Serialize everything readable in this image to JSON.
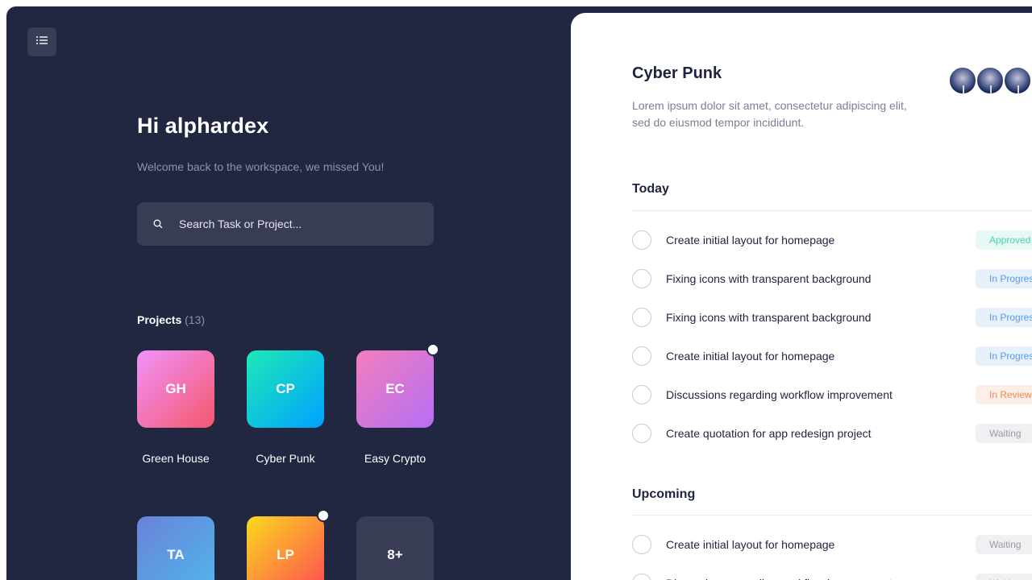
{
  "sidebar": {
    "menu_icon": "list-icon",
    "greeting": "Hi alphardex",
    "subtitle": "Welcome back to the workspace, we missed You!",
    "search": {
      "placeholder": "Search Task or Project...",
      "icon": "search-icon"
    },
    "projects_label": "Projects",
    "projects_count": "(13)",
    "projects": [
      {
        "initials": "GH",
        "name": "Green House",
        "gradient": [
          "#f093fb",
          "#f5576c"
        ],
        "notification": false
      },
      {
        "initials": "CP",
        "name": "Cyber Punk",
        "gradient": [
          "#1de9b6",
          "#00a2ff"
        ],
        "notification": false
      },
      {
        "initials": "EC",
        "name": "Easy Crypto",
        "gradient": [
          "#f37ebd",
          "#b66ef5"
        ],
        "notification": true
      },
      {
        "initials": "TA",
        "name": "",
        "gradient": [
          "#6a82d8",
          "#4fb6ec"
        ],
        "notification": false
      },
      {
        "initials": "LP",
        "name": "",
        "gradient": [
          "#fcd91e",
          "#fb4c52"
        ],
        "notification": true
      },
      {
        "initials": "8+",
        "name": "",
        "gradient": [
          "#383c55",
          "#383c55"
        ],
        "notification": false
      }
    ]
  },
  "panel": {
    "title": "Cyber Punk",
    "description": "Lorem ipsum dolor sit amet, consectetur adipiscing elit, sed do eiusmod tempor incididunt.",
    "avatar_count": 3,
    "today_label": "Today",
    "upcoming_label": "Upcoming",
    "today_tasks": [
      {
        "text": "Create initial layout for homepage",
        "status": "Approved"
      },
      {
        "text": "Fixing icons with transparent background",
        "status": "In Progress"
      },
      {
        "text": "Fixing icons with transparent background",
        "status": "In Progress"
      },
      {
        "text": "Create initial layout for homepage",
        "status": "In Progress"
      },
      {
        "text": "Discussions regarding workflow improvement",
        "status": "In Review"
      },
      {
        "text": "Create quotation for app redesign project",
        "status": "Waiting"
      }
    ],
    "upcoming_tasks": [
      {
        "text": "Create initial layout for homepage",
        "status": "Waiting"
      },
      {
        "text": "Discussions regarding workflow improvement",
        "status": "Waiting"
      }
    ]
  },
  "status_colors": {
    "Approved": {
      "bg": "#e6f9f4",
      "fg": "#4cd1b0"
    },
    "In Progress": {
      "bg": "#e7f1fd",
      "fg": "#5a9ae8"
    },
    "In Review": {
      "bg": "#fdeee7",
      "fg": "#f08a5d"
    },
    "Waiting": {
      "bg": "#f0f0f2",
      "fg": "#9a9aa5"
    }
  }
}
